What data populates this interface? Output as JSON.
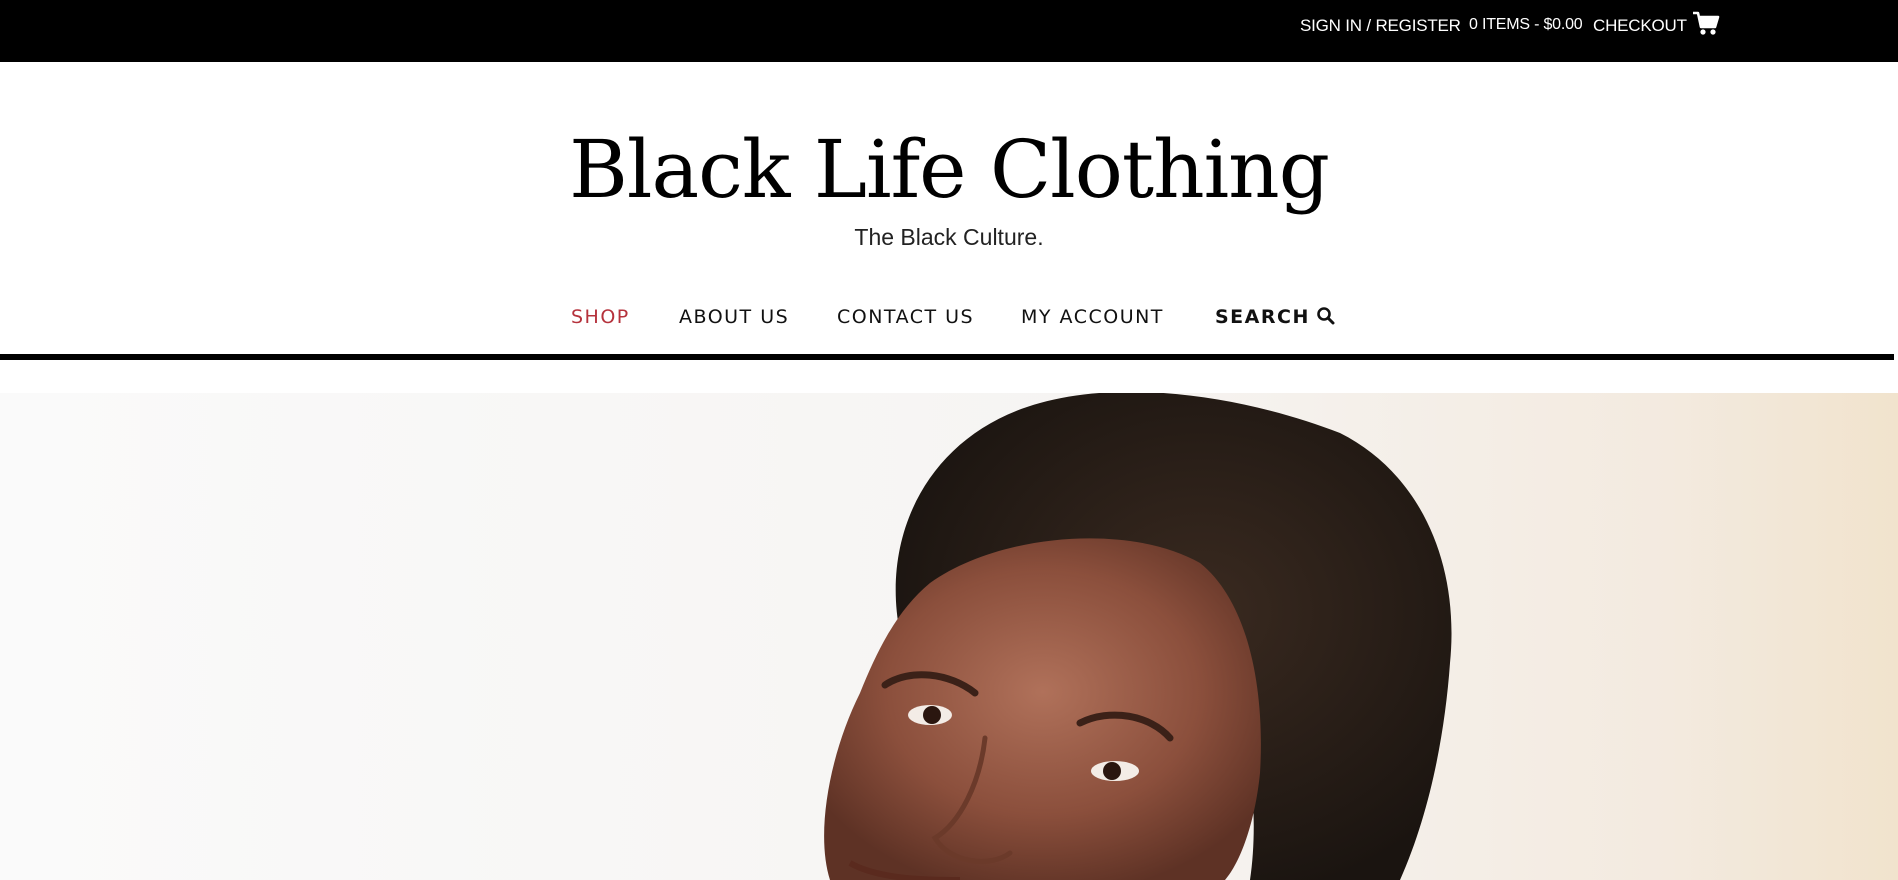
{
  "topbar": {
    "signin_label": "SIGN IN / REGISTER",
    "cart_summary": "0 ITEMS - $0.00",
    "checkout_label": "CHECKOUT",
    "cart_icon": "shopping-cart-icon"
  },
  "header": {
    "site_title": "Black Life Clothing",
    "tagline": "The Black Culture."
  },
  "nav": {
    "items": [
      {
        "label": "SHOP",
        "active": true
      },
      {
        "label": "ABOUT US",
        "active": false
      },
      {
        "label": "CONTACT US",
        "active": false
      },
      {
        "label": "MY ACCOUNT",
        "active": false
      }
    ],
    "search_label": "SEARCH",
    "search_icon": "search-icon"
  },
  "colors": {
    "topbar_bg": "#000000",
    "active_nav": "#b5323c",
    "text": "#111111"
  }
}
